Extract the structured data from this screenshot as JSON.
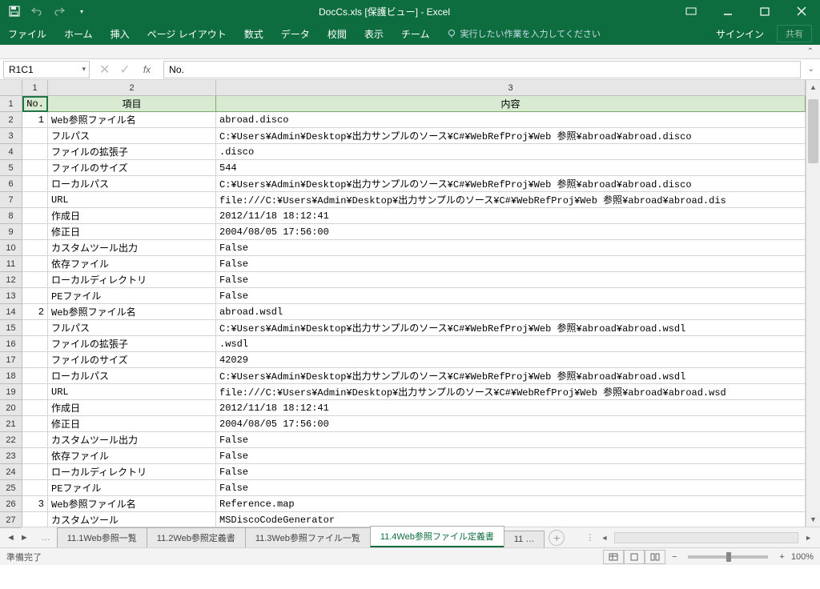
{
  "window": {
    "title": "DocCs.xls  [保護ビュー] - Excel",
    "signin": "サインイン",
    "share": "共有"
  },
  "ribbon": {
    "tabs": [
      "ファイル",
      "ホーム",
      "挿入",
      "ページ レイアウト",
      "数式",
      "データ",
      "校閲",
      "表示",
      "チーム"
    ],
    "tellme": "実行したい作業を入力してください"
  },
  "namebox": "R1C1",
  "formula": "No.",
  "columns": {
    "c1": "1",
    "c2": "2",
    "c3": "3"
  },
  "headers": {
    "no": "No.",
    "item": "項目",
    "content": "内容"
  },
  "rows": [
    {
      "n": "1",
      "no": "1",
      "item": "Web参照ファイル名",
      "val": "abroad.disco"
    },
    {
      "n": "2",
      "no": "",
      "item": "フルパス",
      "val": "C:¥Users¥Admin¥Desktop¥出力サンプルのソース¥C#¥WebRefProj¥Web 参照¥abroad¥abroad.disco"
    },
    {
      "n": "3",
      "no": "",
      "item": "ファイルの拡張子",
      "val": ".disco"
    },
    {
      "n": "4",
      "no": "",
      "item": "ファイルのサイズ",
      "val": "544"
    },
    {
      "n": "5",
      "no": "",
      "item": "ローカルパス",
      "val": "C:¥Users¥Admin¥Desktop¥出力サンプルのソース¥C#¥WebRefProj¥Web 参照¥abroad¥abroad.disco"
    },
    {
      "n": "6",
      "no": "",
      "item": "URL",
      "val": "file:///C:¥Users¥Admin¥Desktop¥出力サンプルのソース¥C#¥WebRefProj¥Web 参照¥abroad¥abroad.dis"
    },
    {
      "n": "7",
      "no": "",
      "item": "作成日",
      "val": "2012/11/18 18:12:41"
    },
    {
      "n": "8",
      "no": "",
      "item": "修正日",
      "val": "2004/08/05 17:56:00"
    },
    {
      "n": "9",
      "no": "",
      "item": "カスタムツール出力",
      "val": "False"
    },
    {
      "n": "10",
      "no": "",
      "item": "依存ファイル",
      "val": "False"
    },
    {
      "n": "11",
      "no": "",
      "item": "ローカルディレクトリ",
      "val": "False"
    },
    {
      "n": "12",
      "no": "",
      "item": "PEファイル",
      "val": "False"
    },
    {
      "n": "13",
      "no": "2",
      "item": "Web参照ファイル名",
      "val": "abroad.wsdl"
    },
    {
      "n": "14",
      "no": "",
      "item": "フルパス",
      "val": "C:¥Users¥Admin¥Desktop¥出力サンプルのソース¥C#¥WebRefProj¥Web 参照¥abroad¥abroad.wsdl"
    },
    {
      "n": "15",
      "no": "",
      "item": "ファイルの拡張子",
      "val": ".wsdl"
    },
    {
      "n": "16",
      "no": "",
      "item": "ファイルのサイズ",
      "val": "42029"
    },
    {
      "n": "17",
      "no": "",
      "item": "ローカルパス",
      "val": "C:¥Users¥Admin¥Desktop¥出力サンプルのソース¥C#¥WebRefProj¥Web 参照¥abroad¥abroad.wsdl"
    },
    {
      "n": "18",
      "no": "",
      "item": "URL",
      "val": "file:///C:¥Users¥Admin¥Desktop¥出力サンプルのソース¥C#¥WebRefProj¥Web 参照¥abroad¥abroad.wsd"
    },
    {
      "n": "19",
      "no": "",
      "item": "作成日",
      "val": "2012/11/18 18:12:41"
    },
    {
      "n": "20",
      "no": "",
      "item": "修正日",
      "val": "2004/08/05 17:56:00"
    },
    {
      "n": "21",
      "no": "",
      "item": "カスタムツール出力",
      "val": "False"
    },
    {
      "n": "22",
      "no": "",
      "item": "依存ファイル",
      "val": "False"
    },
    {
      "n": "23",
      "no": "",
      "item": "ローカルディレクトリ",
      "val": "False"
    },
    {
      "n": "24",
      "no": "",
      "item": "PEファイル",
      "val": "False"
    },
    {
      "n": "25",
      "no": "3",
      "item": "Web参照ファイル名",
      "val": "Reference.map"
    },
    {
      "n": "26",
      "no": "",
      "item": "カスタムツール",
      "val": "MSDiscoCodeGenerator"
    }
  ],
  "rownums": [
    "1",
    "2",
    "3",
    "4",
    "5",
    "6",
    "7",
    "8",
    "9",
    "10",
    "11",
    "12",
    "13",
    "14",
    "15",
    "16",
    "17",
    "18",
    "19",
    "20",
    "21",
    "22",
    "23",
    "24",
    "25",
    "26",
    "27"
  ],
  "sheets": {
    "ellipsis": "…",
    "tabs": [
      "11.1Web参照一覧",
      "11.2Web参照定義書",
      "11.3Web参照ファイル一覧",
      "11.4Web参照ファイル定義書",
      "11 …"
    ],
    "active_index": 3
  },
  "status": {
    "ready": "準備完了",
    "zoom": "100%"
  }
}
